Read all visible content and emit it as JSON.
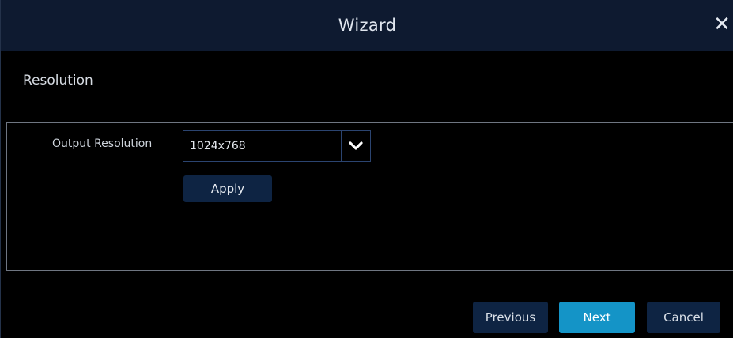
{
  "window": {
    "title": "Wizard",
    "close_icon": "close-icon"
  },
  "section": {
    "title": "Resolution"
  },
  "output_resolution": {
    "label": "Output Resolution",
    "selected_value": "1024x768",
    "dropdown_icon": "chevron-down-icon"
  },
  "actions": {
    "apply_label": "Apply"
  },
  "footer": {
    "previous_label": "Previous",
    "next_label": "Next",
    "cancel_label": "Cancel"
  },
  "colors": {
    "titlebar": "#0e1a30",
    "button_dark": "#0e2443",
    "button_accent": "#1494c7",
    "background": "#000000"
  }
}
